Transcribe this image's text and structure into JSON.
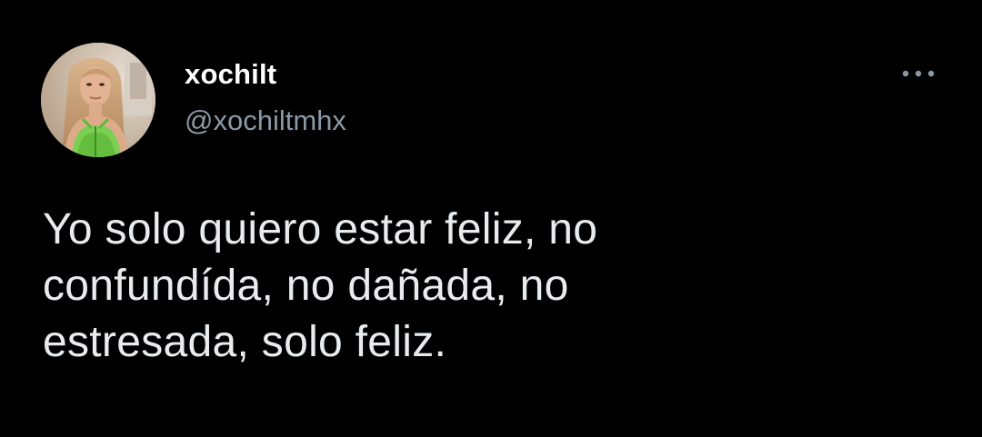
{
  "author": {
    "display_name": "xochilt",
    "handle": "@xochiltmhx",
    "avatar_icon": "profile-photo"
  },
  "menu": {
    "icon": "more-options-icon"
  },
  "tweet": {
    "lines": [
      "Yo solo quiero estar feliz, no",
      "confundída, no dañada, no",
      "estresada, solo feliz."
    ]
  },
  "colors": {
    "background": "#000000",
    "text": "#e9ecee",
    "secondary_text": "#8b98a5"
  }
}
